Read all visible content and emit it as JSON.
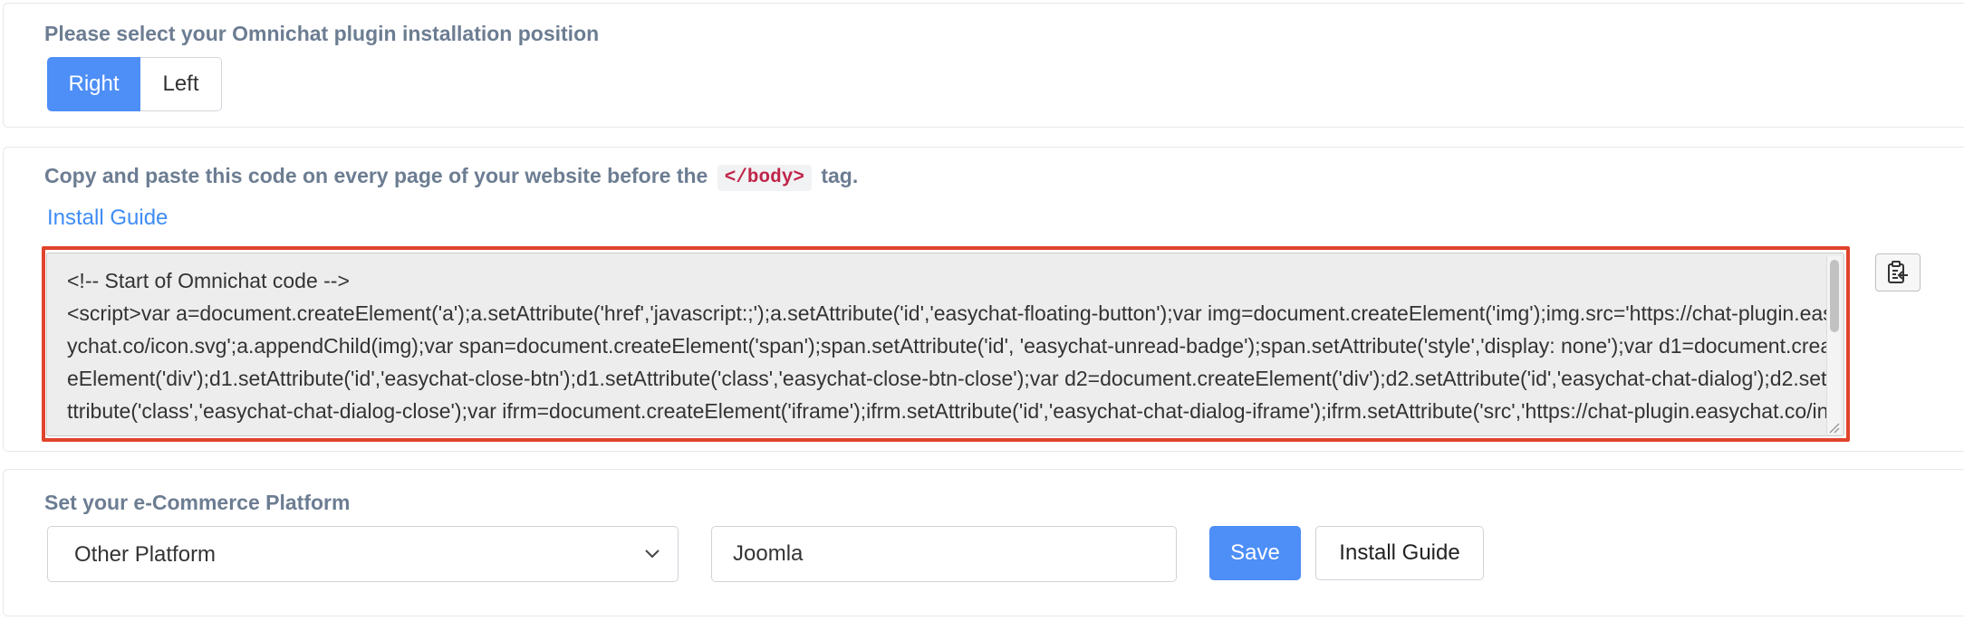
{
  "position_section": {
    "label": "Please select your Omnichat plugin installation position",
    "options": [
      "Right",
      "Left"
    ],
    "selected": "Right"
  },
  "code_section": {
    "instruction_before": "Copy and paste this code on every page of your website before the",
    "inline_code": "</body>",
    "instruction_after": "tag.",
    "install_guide_link": "Install Guide",
    "code": "<!-- Start of Omnichat code -->\n<script>var a=document.createElement('a');a.setAttribute('href','javascript:;');a.setAttribute('id','easychat-floating-button');var img=document.createElement('img');img.src='https://chat-plugin.easychat.co/icon.svg';a.appendChild(img);var span=document.createElement('span');span.setAttribute('id', 'easychat-unread-badge');span.setAttribute('style','display: none');var d1=document.createElement('div');d1.setAttribute('id','easychat-close-btn');d1.setAttribute('class','easychat-close-btn-close');var d2=document.createElement('div');d2.setAttribute('id','easychat-chat-dialog');d2.setAttribute('class','easychat-chat-dialog-close');var ifrm=document.createElement('iframe');ifrm.setAttribute('id','easychat-chat-dialog-iframe');ifrm.setAttribute('src','https://chat-plugin.easychat.co/index.html?appkey=...');",
    "copy_icon": "clipboard-copy-icon"
  },
  "platform_section": {
    "label": "Set your e-Commerce Platform",
    "platform_selected": "Other Platform",
    "platform_name_value": "Joomla",
    "save_label": "Save",
    "install_guide_label": "Install Guide"
  },
  "colors": {
    "primary": "#4d8ef7",
    "link": "#3f8cf4",
    "highlight_border": "#e0442c",
    "label": "#6c7d92",
    "inline_code": "#c0254a"
  }
}
